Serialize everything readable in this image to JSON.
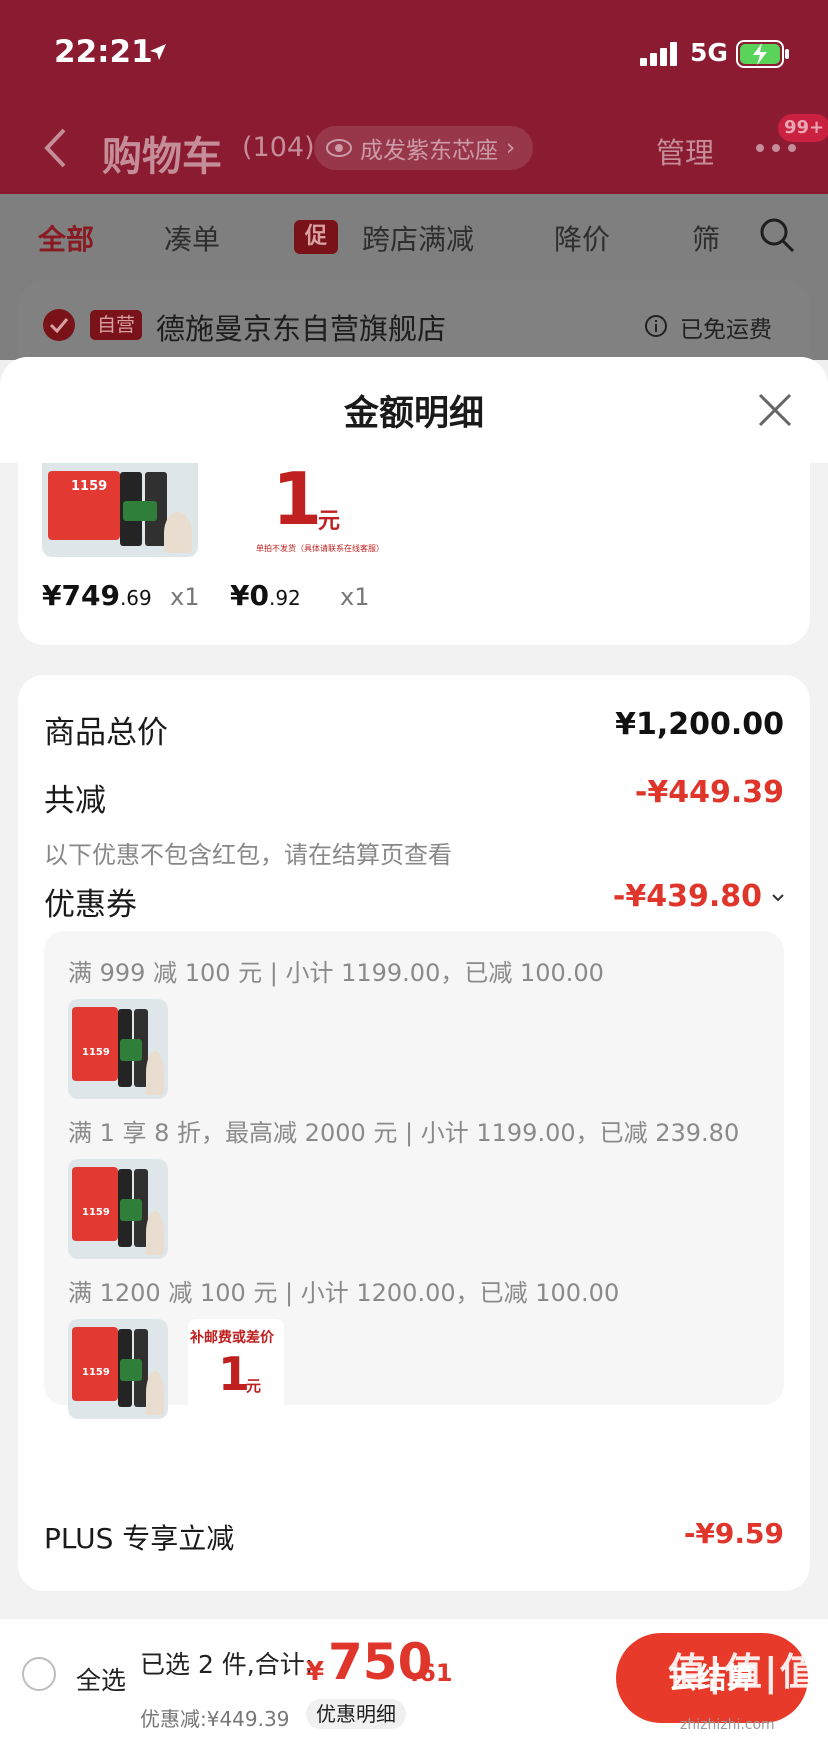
{
  "status_bar": {
    "time": "22:21",
    "network": "5G"
  },
  "header": {
    "title": "购物车",
    "count": "(104)",
    "address": "成发紫东芯座",
    "manage": "管理",
    "message_badge": "99+"
  },
  "tabs": [
    {
      "label": "全部"
    },
    {
      "label": "凑单"
    },
    {
      "label": "跨店满减",
      "badge": "促"
    },
    {
      "label": "降价"
    },
    {
      "label": "筛"
    }
  ],
  "store": {
    "badge": "自营",
    "name": "德施曼京东自营旗舰店",
    "shipping": "已免运费"
  },
  "sheet": {
    "title": "金额明细",
    "goods": [
      {
        "price_int": "¥749",
        "price_dec": ".69",
        "qty": "x1",
        "thumb_price": "1159"
      },
      {
        "price_int": "¥0",
        "price_dec": ".92",
        "qty": "x1",
        "big": "1",
        "unit": "元",
        "note": "单拍不发货（具体请联系在线客服）"
      }
    ],
    "total_label": "商品总价",
    "total_value": "¥1,200.00",
    "reduce_label": "共减",
    "reduce_value": "-¥449.39",
    "hint": "以下优惠不包含红包，请在结算页查看",
    "coupon_label": "优惠券",
    "coupon_value": "-¥439.80",
    "coupons": [
      {
        "text": "满 999 减 100 元 | 小计 1199.00，已减 100.00"
      },
      {
        "text": "满 1 享 8 折，最高减 2000 元 | 小计 1199.00，已减 239.80"
      },
      {
        "text": "满 1200 减 100 元 | 小计 1200.00，已减 100.00"
      }
    ],
    "coupon_thumb_price": "1159",
    "postage_box": {
      "head": "补邮费或差价",
      "big": "1",
      "unit": "元"
    },
    "plus_label": "PLUS 专享立减",
    "plus_value": "-¥9.59"
  },
  "bottom_bar": {
    "select_all": "全选",
    "summary": "已选 2 件,合计:",
    "total_symbol": "¥",
    "total_int": "750",
    "total_dec": ".61",
    "discount": "优惠减:¥449.39",
    "detail_link": "优惠明细",
    "checkout": "去结算",
    "watermark": "值|值|值",
    "watermark_url": "zhizhizhi.com"
  },
  "colors": {
    "accent_red": "#e0352b",
    "header_bg": "#8a1b31",
    "checkout_bg": "#e83a2a"
  }
}
